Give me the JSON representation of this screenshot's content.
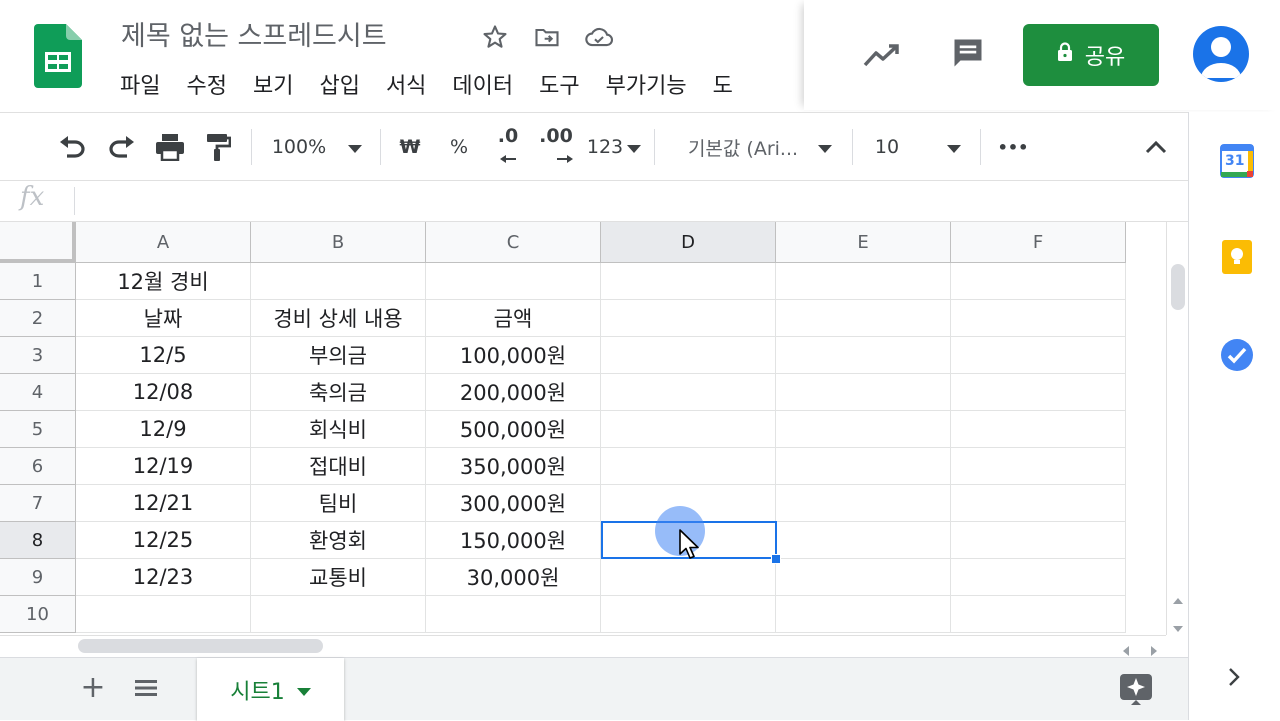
{
  "header": {
    "title": "제목 없는 스프레드시트",
    "menu": [
      "파일",
      "수정",
      "보기",
      "삽입",
      "서식",
      "데이터",
      "도구",
      "부가기능",
      "도"
    ],
    "share_label": "공유",
    "icons": [
      "sheets-logo-icon",
      "star-icon",
      "move-to-folder-icon",
      "cloud-saved-icon",
      "activity-trend-icon",
      "comment-icon",
      "lock-icon",
      "account-avatar-icon"
    ],
    "accent_color": "#1e8e3e"
  },
  "toolbar": {
    "zoom": "100%",
    "currency": "₩",
    "percent": "%",
    "decrease_decimal": ".0",
    "increase_decimal": ".00",
    "number_format": "123",
    "font": "기본값 (Ari...",
    "font_size": "10",
    "more": "•••"
  },
  "formula_bar": {
    "fx_label": "fx",
    "value": ""
  },
  "grid": {
    "columns": [
      "A",
      "B",
      "C",
      "D",
      "E",
      "F"
    ],
    "rows": [
      "1",
      "2",
      "3",
      "4",
      "5",
      "6",
      "7",
      "8",
      "9",
      "10"
    ],
    "cells": [
      [
        "12월 경비",
        "",
        "",
        "",
        "",
        ""
      ],
      [
        "날짜",
        "경비 상세 내용",
        "금액",
        "",
        "",
        ""
      ],
      [
        "12/5",
        "부의금",
        "100,000원",
        "",
        "",
        ""
      ],
      [
        "12/08",
        "축의금",
        "200,000원",
        "",
        "",
        ""
      ],
      [
        "12/9",
        "회식비",
        "500,000원",
        "",
        "",
        ""
      ],
      [
        "12/19",
        "접대비",
        "350,000원",
        "",
        "",
        ""
      ],
      [
        "12/21",
        "팀비",
        "300,000원",
        "",
        "",
        ""
      ],
      [
        "12/25",
        "환영회",
        "150,000원",
        "",
        "",
        ""
      ],
      [
        "12/23",
        "교통비",
        "30,000원",
        "",
        "",
        ""
      ],
      [
        "",
        "",
        "",
        "",
        "",
        ""
      ]
    ],
    "selected_cell": "D8",
    "selection_color": "#1a73e8"
  },
  "bottom": {
    "add_sheet": "+",
    "sheet_name": "시트1"
  },
  "side_panel": {
    "calendar_day": "31",
    "apps": [
      "calendar-icon",
      "keep-icon",
      "tasks-icon"
    ]
  }
}
